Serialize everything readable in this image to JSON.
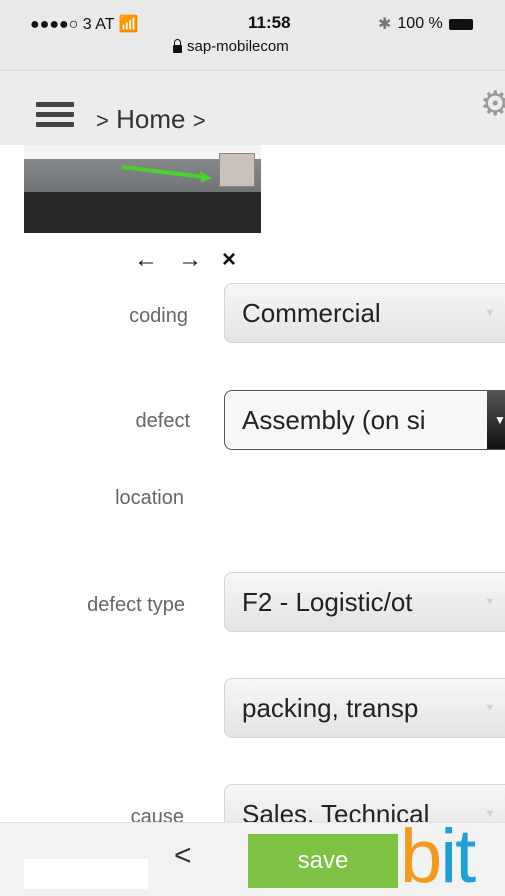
{
  "status_bar": {
    "carrier": "●●●●○ 3 AT",
    "time": "11:58",
    "battery": "100 %",
    "url": "sap-mobilecom"
  },
  "header": {
    "sep": ">",
    "breadcrumb_item": "Home",
    "icons": {
      "menu": "hamburger-icon",
      "settings": "gear-icon"
    }
  },
  "image_controls": {
    "prev": "←",
    "next": "→",
    "delete": "×"
  },
  "form": {
    "coding": {
      "label": "coding",
      "value": "Commercial"
    },
    "defect": {
      "label": "defect",
      "value": "Assembly (on si"
    },
    "location": {
      "label": "location"
    },
    "defect_type": {
      "label": "defect type",
      "value": "F2 - Logistic/ot"
    },
    "defect_subtype": {
      "value": "packing, transp"
    },
    "cause": {
      "label": "cause",
      "value": "Sales, Technical"
    }
  },
  "bottom_bar": {
    "back": "<",
    "save_label": "save",
    "logo_b": "b",
    "logo_it": "it"
  },
  "colors": {
    "save_green": "#7dc242",
    "logo_orange": "#f39a1e",
    "logo_blue": "#1f9fd8"
  }
}
